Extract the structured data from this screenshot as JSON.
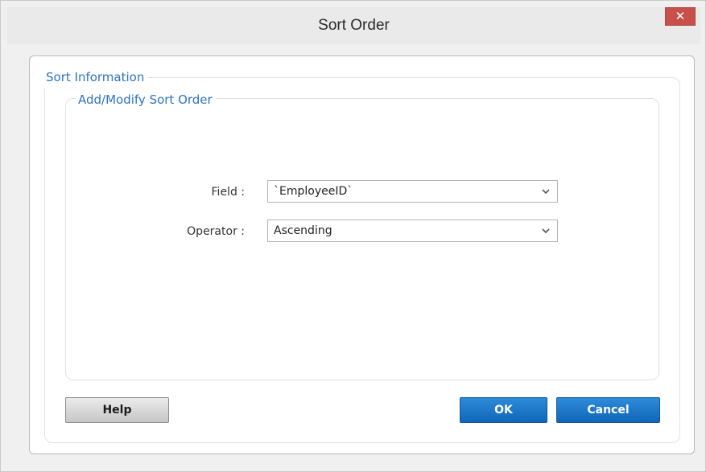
{
  "window": {
    "title": "Sort Order",
    "close_glyph": "✕"
  },
  "sort_information": {
    "legend": "Sort Information",
    "add_modify": {
      "legend": "Add/Modify Sort Order",
      "field": {
        "label": "Field :",
        "value": "`EmployeeID`"
      },
      "operator": {
        "label": "Operator :",
        "value": "Ascending"
      }
    }
  },
  "buttons": {
    "help": "Help",
    "ok": "OK",
    "cancel": "Cancel"
  },
  "colors": {
    "accent_blue": "#1a73c9",
    "legend_blue": "#2f73c2",
    "close_red": "#c7504b"
  },
  "icons": {
    "close": "close-icon",
    "dropdown": "chevron-down-icon"
  }
}
